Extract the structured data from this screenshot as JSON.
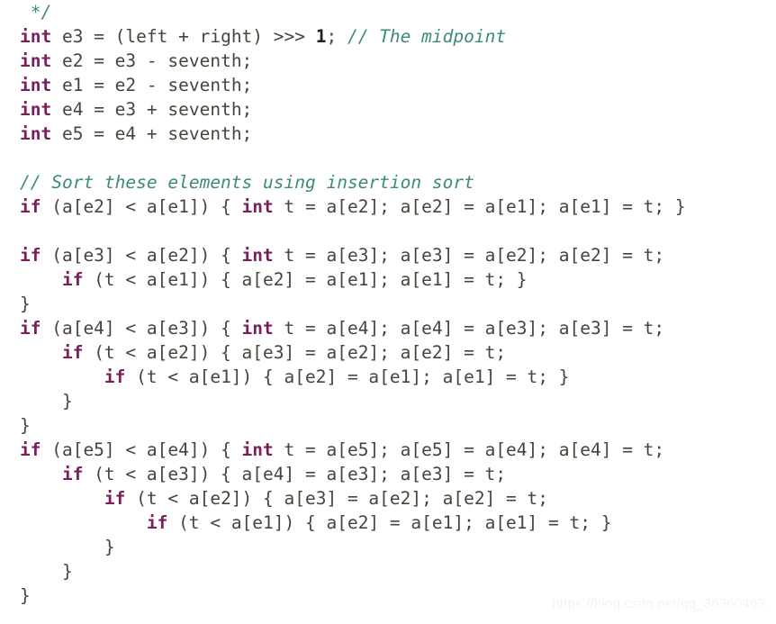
{
  "editor": {
    "language": "java",
    "background_color": "#ffffff",
    "font_size_px": 19.5,
    "line_height_px": 27,
    "colors": {
      "keyword": "#7a1f5c",
      "comment": "#3b8b7b",
      "plain": "#4a433c",
      "number": "#24201c",
      "background": "#ffffff",
      "watermark": "#f2f2f2"
    }
  },
  "watermark": {
    "text": "https://blog.csdn.net/qq_36360463"
  },
  "code": {
    "lines": [
      {
        "index": 1,
        "text": " */",
        "tokens": [
          {
            "t": " ",
            "k": "plain"
          },
          {
            "t": "*/",
            "k": "cmt"
          }
        ]
      },
      {
        "index": 2,
        "text": "int e3 = (left + right) >>> 1; // The midpoint",
        "tokens": [
          {
            "t": "int",
            "k": "kw"
          },
          {
            "t": " e3 = (left + right) >>> ",
            "k": "plain"
          },
          {
            "t": "1",
            "k": "num"
          },
          {
            "t": "; ",
            "k": "plain"
          },
          {
            "t": "// The midpoint",
            "k": "cmt"
          }
        ]
      },
      {
        "index": 3,
        "text": "int e2 = e3 - seventh;",
        "tokens": [
          {
            "t": "int",
            "k": "kw"
          },
          {
            "t": " e2 = e3 - seventh;",
            "k": "plain"
          }
        ]
      },
      {
        "index": 4,
        "text": "int e1 = e2 - seventh;",
        "tokens": [
          {
            "t": "int",
            "k": "kw"
          },
          {
            "t": " e1 = e2 - seventh;",
            "k": "plain"
          }
        ]
      },
      {
        "index": 5,
        "text": "int e4 = e3 + seventh;",
        "tokens": [
          {
            "t": "int",
            "k": "kw"
          },
          {
            "t": " e4 = e3 + seventh;",
            "k": "plain"
          }
        ]
      },
      {
        "index": 6,
        "text": "int e5 = e4 + seventh;",
        "tokens": [
          {
            "t": "int",
            "k": "kw"
          },
          {
            "t": " e5 = e4 + seventh;",
            "k": "plain"
          }
        ]
      },
      {
        "index": 7,
        "text": "",
        "tokens": []
      },
      {
        "index": 8,
        "text": "// Sort these elements using insertion sort",
        "tokens": [
          {
            "t": "// Sort these elements using insertion sort",
            "k": "cmt"
          }
        ]
      },
      {
        "index": 9,
        "text": "if (a[e2] < a[e1]) { int t = a[e2]; a[e2] = a[e1]; a[e1] = t; }",
        "tokens": [
          {
            "t": "if",
            "k": "kw"
          },
          {
            "t": " (a[e2] < a[e1]) { ",
            "k": "plain"
          },
          {
            "t": "int",
            "k": "kw"
          },
          {
            "t": " t = a[e2]; a[e2] = a[e1]; a[e1] = t; }",
            "k": "plain"
          }
        ]
      },
      {
        "index": 10,
        "text": "",
        "tokens": []
      },
      {
        "index": 11,
        "text": "if (a[e3] < a[e2]) { int t = a[e3]; a[e3] = a[e2]; a[e2] = t;",
        "tokens": [
          {
            "t": "if",
            "k": "kw"
          },
          {
            "t": " (a[e3] < a[e2]) { ",
            "k": "plain"
          },
          {
            "t": "int",
            "k": "kw"
          },
          {
            "t": " t = a[e3]; a[e3] = a[e2]; a[e2] = t;",
            "k": "plain"
          }
        ]
      },
      {
        "index": 12,
        "text": "    if (t < a[e1]) { a[e2] = a[e1]; a[e1] = t; }",
        "tokens": [
          {
            "t": "    ",
            "k": "plain"
          },
          {
            "t": "if",
            "k": "kw"
          },
          {
            "t": " (t < a[e1]) { a[e2] = a[e1]; a[e1] = t; }",
            "k": "plain"
          }
        ]
      },
      {
        "index": 13,
        "text": "}",
        "tokens": [
          {
            "t": "}",
            "k": "plain"
          }
        ]
      },
      {
        "index": 14,
        "text": "if (a[e4] < a[e3]) { int t = a[e4]; a[e4] = a[e3]; a[e3] = t;",
        "tokens": [
          {
            "t": "if",
            "k": "kw"
          },
          {
            "t": " (a[e4] < a[e3]) { ",
            "k": "plain"
          },
          {
            "t": "int",
            "k": "kw"
          },
          {
            "t": " t = a[e4]; a[e4] = a[e3]; a[e3] = t;",
            "k": "plain"
          }
        ]
      },
      {
        "index": 15,
        "text": "    if (t < a[e2]) { a[e3] = a[e2]; a[e2] = t;",
        "tokens": [
          {
            "t": "    ",
            "k": "plain"
          },
          {
            "t": "if",
            "k": "kw"
          },
          {
            "t": " (t < a[e2]) { a[e3] = a[e2]; a[e2] = t;",
            "k": "plain"
          }
        ]
      },
      {
        "index": 16,
        "text": "        if (t < a[e1]) { a[e2] = a[e1]; a[e1] = t; }",
        "tokens": [
          {
            "t": "        ",
            "k": "plain"
          },
          {
            "t": "if",
            "k": "kw"
          },
          {
            "t": " (t < a[e1]) { a[e2] = a[e1]; a[e1] = t; }",
            "k": "plain"
          }
        ]
      },
      {
        "index": 17,
        "text": "    }",
        "tokens": [
          {
            "t": "    }",
            "k": "plain"
          }
        ]
      },
      {
        "index": 18,
        "text": "}",
        "tokens": [
          {
            "t": "}",
            "k": "plain"
          }
        ]
      },
      {
        "index": 19,
        "text": "if (a[e5] < a[e4]) { int t = a[e5]; a[e5] = a[e4]; a[e4] = t;",
        "tokens": [
          {
            "t": "if",
            "k": "kw"
          },
          {
            "t": " (a[e5] < a[e4]) { ",
            "k": "plain"
          },
          {
            "t": "int",
            "k": "kw"
          },
          {
            "t": " t = a[e5]; a[e5] = a[e4]; a[e4] = t;",
            "k": "plain"
          }
        ]
      },
      {
        "index": 20,
        "text": "    if (t < a[e3]) { a[e4] = a[e3]; a[e3] = t;",
        "tokens": [
          {
            "t": "    ",
            "k": "plain"
          },
          {
            "t": "if",
            "k": "kw"
          },
          {
            "t": " (t < a[e3]) { a[e4] = a[e3]; a[e3] = t;",
            "k": "plain"
          }
        ]
      },
      {
        "index": 21,
        "text": "        if (t < a[e2]) { a[e3] = a[e2]; a[e2] = t;",
        "tokens": [
          {
            "t": "        ",
            "k": "plain"
          },
          {
            "t": "if",
            "k": "kw"
          },
          {
            "t": " (t < a[e2]) { a[e3] = a[e2]; a[e2] = t;",
            "k": "plain"
          }
        ]
      },
      {
        "index": 22,
        "text": "            if (t < a[e1]) { a[e2] = a[e1]; a[e1] = t; }",
        "tokens": [
          {
            "t": "            ",
            "k": "plain"
          },
          {
            "t": "if",
            "k": "kw"
          },
          {
            "t": " (t < a[e1]) { a[e2] = a[e1]; a[e1] = t; }",
            "k": "plain"
          }
        ]
      },
      {
        "index": 23,
        "text": "        }",
        "tokens": [
          {
            "t": "        }",
            "k": "plain"
          }
        ]
      },
      {
        "index": 24,
        "text": "    }",
        "tokens": [
          {
            "t": "    }",
            "k": "plain"
          }
        ]
      },
      {
        "index": 25,
        "text": "}",
        "tokens": [
          {
            "t": "}",
            "k": "plain"
          }
        ]
      }
    ]
  }
}
